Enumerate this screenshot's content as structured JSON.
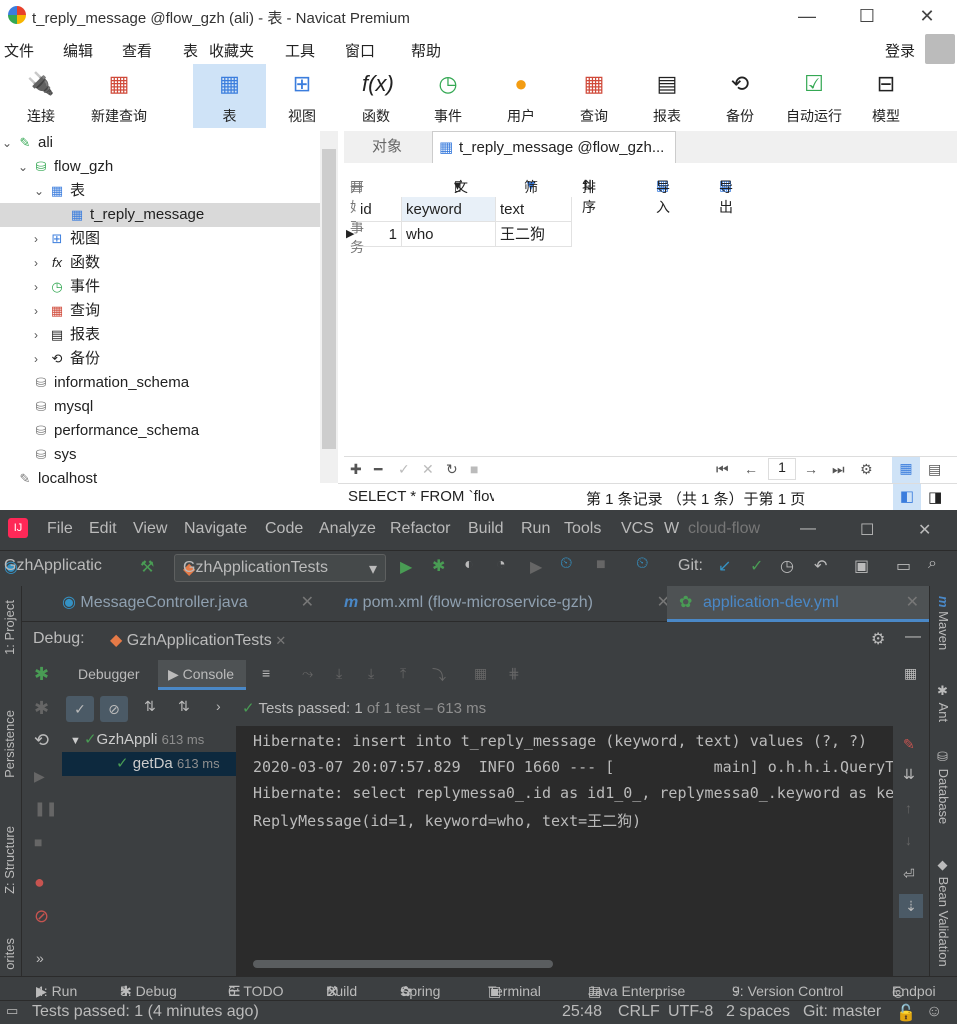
{
  "navicat": {
    "window_title": "t_reply_message @flow_gzh (ali) - 表 - Navicat Premium",
    "menu": [
      "文件",
      "编辑",
      "查看",
      "表",
      "收藏夹",
      "工具",
      "窗口",
      "帮助"
    ],
    "login": "登录",
    "toolbar": [
      "连接",
      "新建查询",
      "表",
      "视图",
      "函数",
      "事件",
      "用户",
      "查询",
      "报表",
      "备份",
      "自动运行",
      "模型"
    ],
    "tree": {
      "connection": "ali",
      "database": "flow_gzh",
      "tables_group": "表",
      "table": "t_reply_message",
      "groups": [
        "视图",
        "函数",
        "事件",
        "查询",
        "报表",
        "备份"
      ],
      "other_dbs": [
        "information_schema",
        "mysql",
        "performance_schema",
        "sys"
      ],
      "connection2": "localhost"
    },
    "tabs": {
      "objects": "对象",
      "active": "t_reply_message @flow_gzh..."
    },
    "subtoolbar": {
      "begin_tx": "开始事务",
      "text": "文本",
      "filter": "筛选",
      "sort": "排序",
      "import": "导入",
      "export": "导出"
    },
    "grid": {
      "columns": [
        "id",
        "keyword",
        "text"
      ],
      "rows": [
        [
          "1",
          "who",
          "王二狗"
        ]
      ]
    },
    "pager": {
      "page": "1"
    },
    "status": {
      "sql": "SELECT * FROM `flov",
      "records": "第 1 条记录 （共 1 条）于第 1 页"
    }
  },
  "ide": {
    "menu": [
      "File",
      "Edit",
      "View",
      "Navigate",
      "Code",
      "Analyze",
      "Refactor",
      "Build",
      "Run",
      "Tools",
      "VCS",
      "W",
      "cloud-flow"
    ],
    "project": "GzhApplicatic",
    "run_config": "GzhApplicationTests",
    "git_label": "Git:",
    "editor_tabs": [
      "MessageController.java",
      "pom.xml (flow-microservice-gzh)",
      "application-dev.yml"
    ],
    "debug_label": "Debug:",
    "debug_session": "GzhApplicationTests",
    "debug_tabs": {
      "debugger": "Debugger",
      "console": "Console"
    },
    "tests_status": {
      "passed": "Tests passed:",
      "count": "1",
      "detail": "of 1 test – 613 ms"
    },
    "test_tree": [
      {
        "name": "GzhAppli",
        "time": "613 ms"
      },
      {
        "name": "getDa",
        "time": "613 ms"
      }
    ],
    "console_lines": [
      "Hibernate: insert into t_reply_message (keyword, text) values (?, ?)",
      "2020-03-07 20:07:57.829  INFO 1660 --- [           main] o.h.h.i.QueryT",
      "Hibernate: select replymessa0_.id as id1_0_, replymessa0_.keyword as ke",
      "ReplyMessage(id=1, keyword=who, text=王二狗)"
    ],
    "left_gutter": [
      "1: Project",
      "Persistence",
      "Z: Structure",
      "orites"
    ],
    "right_gutter": [
      "Maven",
      "Ant",
      "Database",
      "Bean Validation"
    ],
    "bottom_tabs": [
      "4: Run",
      "5: Debug",
      "6: TODO",
      "Build",
      "Spring",
      "Terminal",
      "Java Enterprise",
      "9: Version Control",
      "Endpoi"
    ],
    "statusbar": {
      "message": "Tests passed: 1 (4 minutes ago)",
      "pos": "25:48",
      "eol": "CRLF",
      "enc": "UTF-8",
      "indent": "2 spaces",
      "branch": "Git: master"
    }
  }
}
